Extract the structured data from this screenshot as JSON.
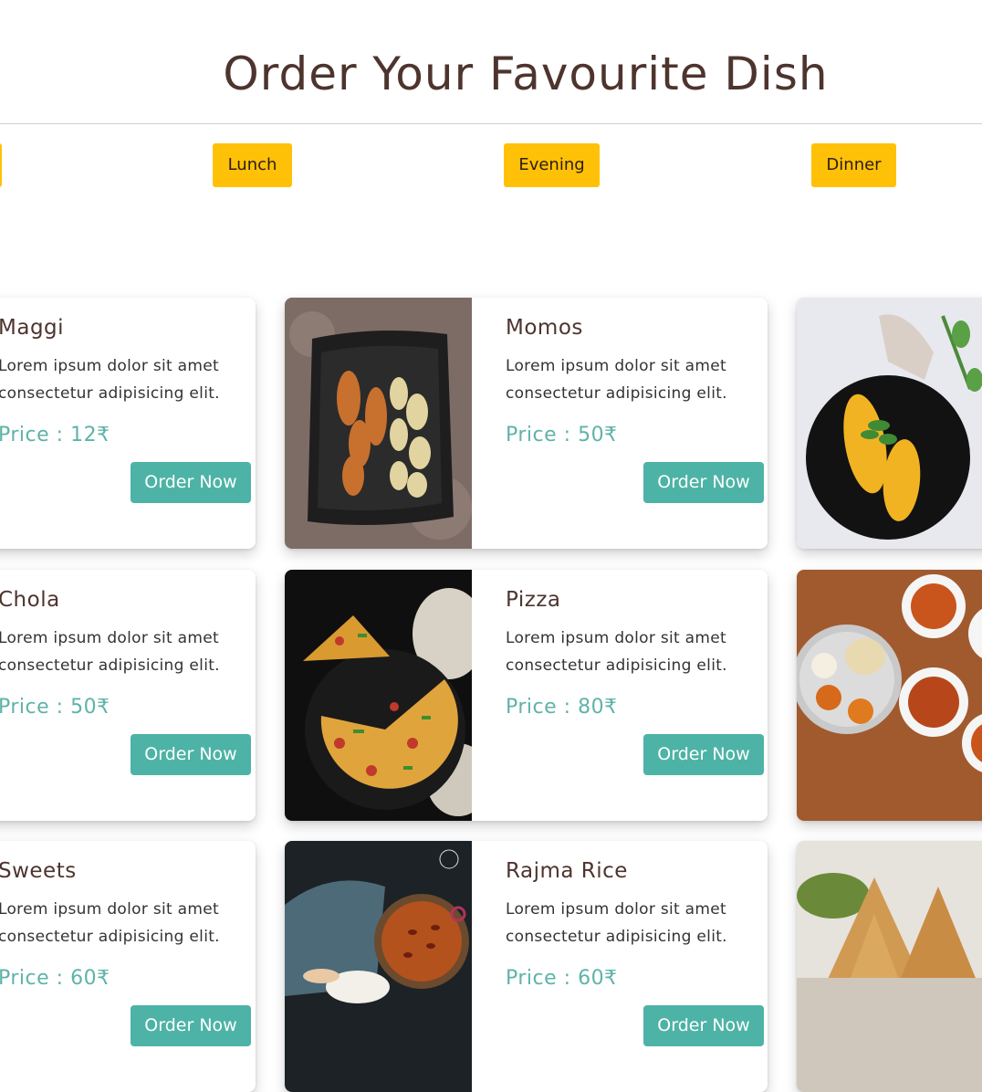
{
  "page": {
    "title": "Order Your Favourite Dish"
  },
  "tabs": [
    {
      "label": "Lunch"
    },
    {
      "label": "Evening"
    },
    {
      "label": "Dinner"
    }
  ],
  "dishes": [
    {
      "name": "Maggi",
      "desc1": "Lorem ipsum dolor sit amet",
      "desc2": "consectetur adipisicing elit.",
      "price": "Price : 12₹",
      "button": "Order Now"
    },
    {
      "name": "Momos",
      "desc1": "Lorem ipsum dolor sit amet",
      "desc2": "consectetur adipisicing elit.",
      "price": "Price : 50₹",
      "button": "Order Now"
    },
    {
      "name": "Chola",
      "desc1": "Lorem ipsum dolor sit amet",
      "desc2": "consectetur adipisicing elit.",
      "price": "Price : 50₹",
      "button": "Order Now"
    },
    {
      "name": "Pizza",
      "desc1": "Lorem ipsum dolor sit amet",
      "desc2": "consectetur adipisicing elit.",
      "price": "Price : 80₹",
      "button": "Order Now"
    },
    {
      "name": "Sweets",
      "desc1": "Lorem ipsum dolor sit amet",
      "desc2": "consectetur adipisicing elit.",
      "price": "Price : 60₹",
      "button": "Order Now"
    },
    {
      "name": "Rajma Rice",
      "desc1": "Lorem ipsum dolor sit amet",
      "desc2": "consectetur adipisicing elit.",
      "price": "Price : 60₹",
      "button": "Order Now"
    }
  ],
  "colors": {
    "accent": "#ffc107",
    "button": "#4db3a6",
    "price": "#5fb3a8",
    "title": "#4e342e"
  },
  "images": [
    "momos-photo",
    "pizza-photo",
    "rajma-rice-photo",
    "corn-photo",
    "thali-photo",
    "samosa-photo"
  ]
}
